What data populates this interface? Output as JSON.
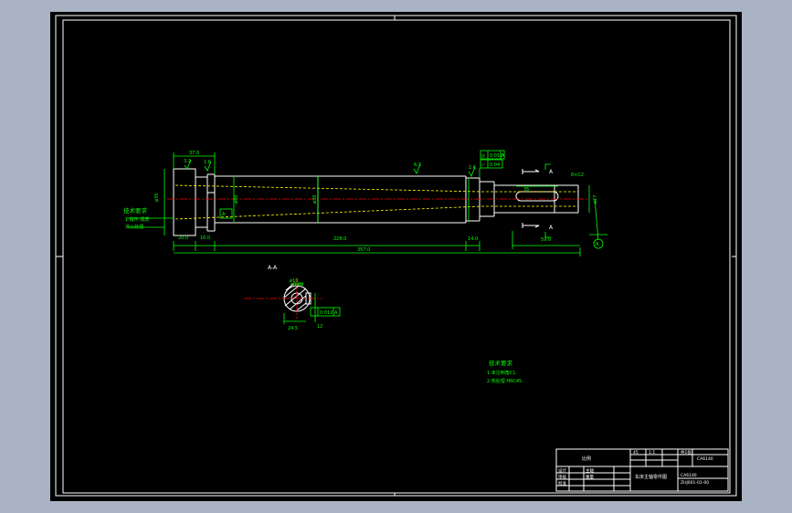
{
  "colors": {
    "background": "#a9b3c3",
    "sheet": "#000000",
    "outline": "#ffffff",
    "dimension": "#00ff00",
    "hidden_line": "#ffff00",
    "center_line": "#ff0000"
  },
  "dims": {
    "d37": "37.0",
    "d20": "20.0",
    "d16": "16.0",
    "d228": "228.0",
    "d357": "357.0",
    "d14": "14.0",
    "d59": "59.0",
    "dia35": "ø35",
    "dia30": "ø30",
    "dia40": "ø40",
    "chamfer": "8×C2",
    "dia_r": "ø27",
    "d35": "35",
    "dia10": "ø10",
    "d245": "24.5",
    "d12": "12"
  },
  "tolerances": {
    "t1": "0.012",
    "t2": "0.04",
    "t3": "0.09",
    "t4": "0.012",
    "datum_a": "A",
    "pos_sym": "◎",
    "flat_sym": "▱"
  },
  "section": {
    "label": "A-A",
    "arrow1": "A",
    "arrow2": "A",
    "datum_marker": "A"
  },
  "roughness": {
    "r1": "3.2",
    "r2": "1.6",
    "r3": "6.3",
    "r4": "1.6"
  },
  "notes": {
    "left_title": "技术要求",
    "left_line1": "1.锻件.调质",
    "left_line2": "淬火处理",
    "right_title": "技术要求",
    "right_line1": "1.未注倒角C1.",
    "right_line2": "2.热处理 HRC45."
  },
  "title_block": {
    "quantity": "比例",
    "design": "设计",
    "check": "审核",
    "approve": "批准",
    "part_name": "主轴",
    "drawing_name": "车床主轴零件图",
    "material": "45",
    "sheet": "共1张",
    "code": "CA6140",
    "code2": "ZHJ001-01-00",
    "scale": "1:1",
    "weight": "重量"
  }
}
